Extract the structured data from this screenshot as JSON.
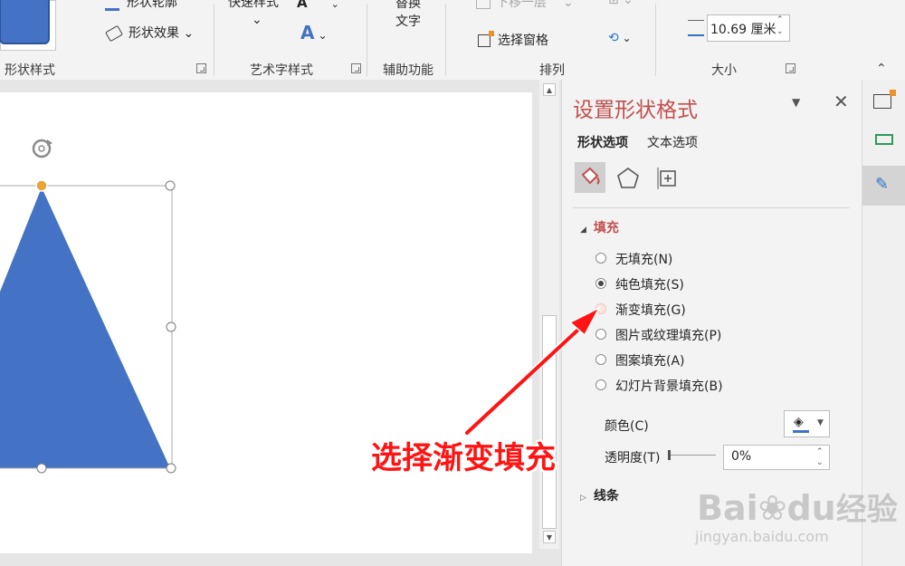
{
  "ribbon": {
    "shape_outline_label": "形状轮廓",
    "shape_effects_label": "形状效果",
    "shape_styles_group": "形状样式",
    "quick_styles_label": "快速样式",
    "wordart_group": "艺术字样式",
    "alt_text_label_line1": "替换",
    "alt_text_label_line2": "文字",
    "accessibility_group": "辅助功能",
    "send_backward_label": "下移一层",
    "selection_pane_label": "选择窗格",
    "arrange_group": "排列",
    "width_value": "10.69 厘米",
    "size_group": "大小"
  },
  "panel": {
    "title": "设置形状格式",
    "tabs": [
      {
        "label": "形状选项"
      },
      {
        "label": "文本选项"
      }
    ],
    "fill_section": "填充",
    "fill_options": [
      {
        "label": "无填充(N)"
      },
      {
        "label": "纯色填充(S)"
      },
      {
        "label": "渐变填充(G)"
      },
      {
        "label": "图片或纹理填充(P)"
      },
      {
        "label": "图案填充(A)"
      },
      {
        "label": "幻灯片背景填充(B)"
      }
    ],
    "color_label": "颜色(C)",
    "transparency_label": "透明度(T)",
    "transparency_value": "0%",
    "line_section": "线条"
  },
  "annotation": {
    "callout_text": "选择渐变填充"
  },
  "watermark": {
    "brand": "Bai",
    "brand2": "du",
    "brand_cn": "经验",
    "url": "jingyan.baidu.com"
  },
  "colors": {
    "shape_fill": "#4472c4",
    "panel_title": "#c0504d",
    "annotation": "#ff1414"
  }
}
